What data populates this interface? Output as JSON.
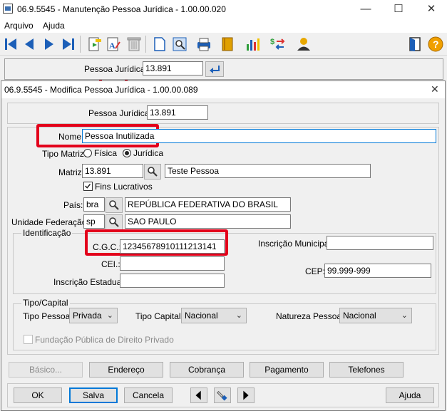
{
  "window": {
    "title": "06.9.5545 - Manutenção Pessoa Jurídica - 1.00.00.020",
    "minimize": "—",
    "maximize": "☐",
    "close": "✕"
  },
  "menu": {
    "items": [
      "Arquivo",
      "Ajuda"
    ]
  },
  "toolbar": {
    "icons": [
      "first-icon",
      "previous-icon",
      "next-icon",
      "last-icon",
      "new-record-icon",
      "edit-record-icon",
      "delete-icon",
      "document-icon",
      "preview-icon",
      "print-icon",
      "book-icon",
      "chart-icon",
      "exchange-icon",
      "user-icon",
      "exit-icon",
      "help-icon"
    ],
    "help_glyph": "?"
  },
  "search": {
    "label": "Pessoa Jurídica:",
    "value": "13.891"
  },
  "dialog": {
    "title": "06.9.5545 - Modifica Pessoa Jurídica - 1.00.00.089",
    "close": "✕",
    "pessoa_juridica_label": "Pessoa Jurídica:",
    "pessoa_juridica_value": "13.891",
    "nome_label": "Nome:",
    "nome_value": "Pessoa Inutilizada",
    "tipo_matriz_label": "Tipo Matriz:",
    "tipo_matriz_options": [
      "Física",
      "Jurídica"
    ],
    "tipo_matriz_selected": "Jurídica",
    "matriz_label": "Matriz:",
    "matriz_code": "13.891",
    "matriz_name": "Teste Pessoa",
    "fins_lucrativos_label": "Fins Lucrativos",
    "fins_lucrativos_checked": true,
    "pais_label": "País:",
    "pais_code": "bra",
    "pais_name": "REPÚBLICA FEDERATIVA DO BRASIL",
    "uf_label": "Unidade Federação:",
    "uf_code": "sp",
    "uf_name": "SAO PAULO",
    "identificacao": {
      "legend": "Identificação",
      "cgc_label": "C.G.C.:",
      "cgc_value": "12345678910111213141",
      "cei_label": "CEI.:",
      "cei_value": "",
      "inscricao_estadual_label": "Inscrição Estadual:",
      "inscricao_estadual_value": "",
      "inscricao_municipal_label": "Inscrição Municipal:",
      "inscricao_municipal_value": "",
      "cep_label": "CEP:",
      "cep_value": "99.999-999"
    },
    "tipo_capital": {
      "legend": "Tipo/Capital",
      "tipo_pessoa_label": "Tipo Pessoa:",
      "tipo_pessoa_value": "Privada",
      "tipo_capital_label": "Tipo Capital:",
      "tipo_capital_value": "Nacional",
      "natureza_pessoa_label": "Natureza Pessoa:",
      "natureza_pessoa_value": "Nacional",
      "fundacao_label": "Fundação Pública de Direito Privado"
    },
    "tabs": [
      "Básico...",
      "Endereço",
      "Cobrança",
      "Pagamento",
      "Telefones"
    ],
    "footer": {
      "ok": "OK",
      "salva": "Salva",
      "cancela": "Cancela",
      "ajuda": "Ajuda"
    }
  },
  "colors": {
    "highlight": "#e3001b",
    "toolbar_blue": "#1c5fb8"
  }
}
